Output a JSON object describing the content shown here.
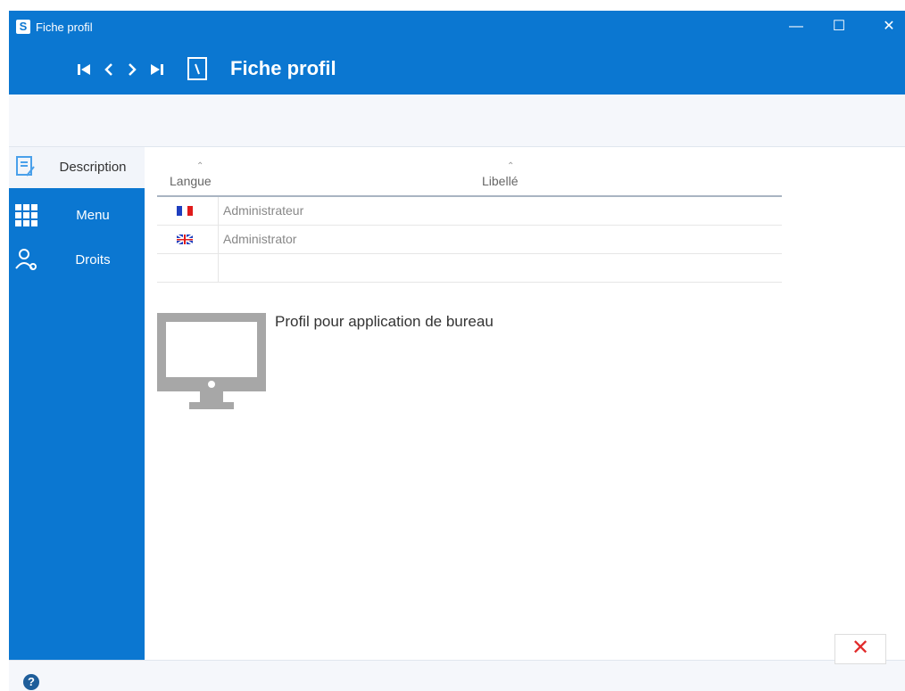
{
  "window": {
    "title": "Fiche profil",
    "app_icon_letter": "S"
  },
  "header": {
    "title": "Fiche profil"
  },
  "sidebar": {
    "items": [
      {
        "label": "Description",
        "icon": "description-icon",
        "active": true
      },
      {
        "label": "Menu",
        "icon": "menu-grid-icon",
        "active": false
      },
      {
        "label": "Droits",
        "icon": "users-rights-icon",
        "active": false
      }
    ]
  },
  "grid": {
    "columns": [
      "Langue",
      "Libellé"
    ],
    "rows": [
      {
        "flag": "fr",
        "label": "Administrateur"
      },
      {
        "flag": "gb",
        "label": "Administrator"
      },
      {
        "flag": "",
        "label": ""
      }
    ]
  },
  "profile": {
    "description": "Profil pour application de bureau"
  },
  "colors": {
    "accent": "#0b77d1",
    "close": "#e12b2b"
  }
}
